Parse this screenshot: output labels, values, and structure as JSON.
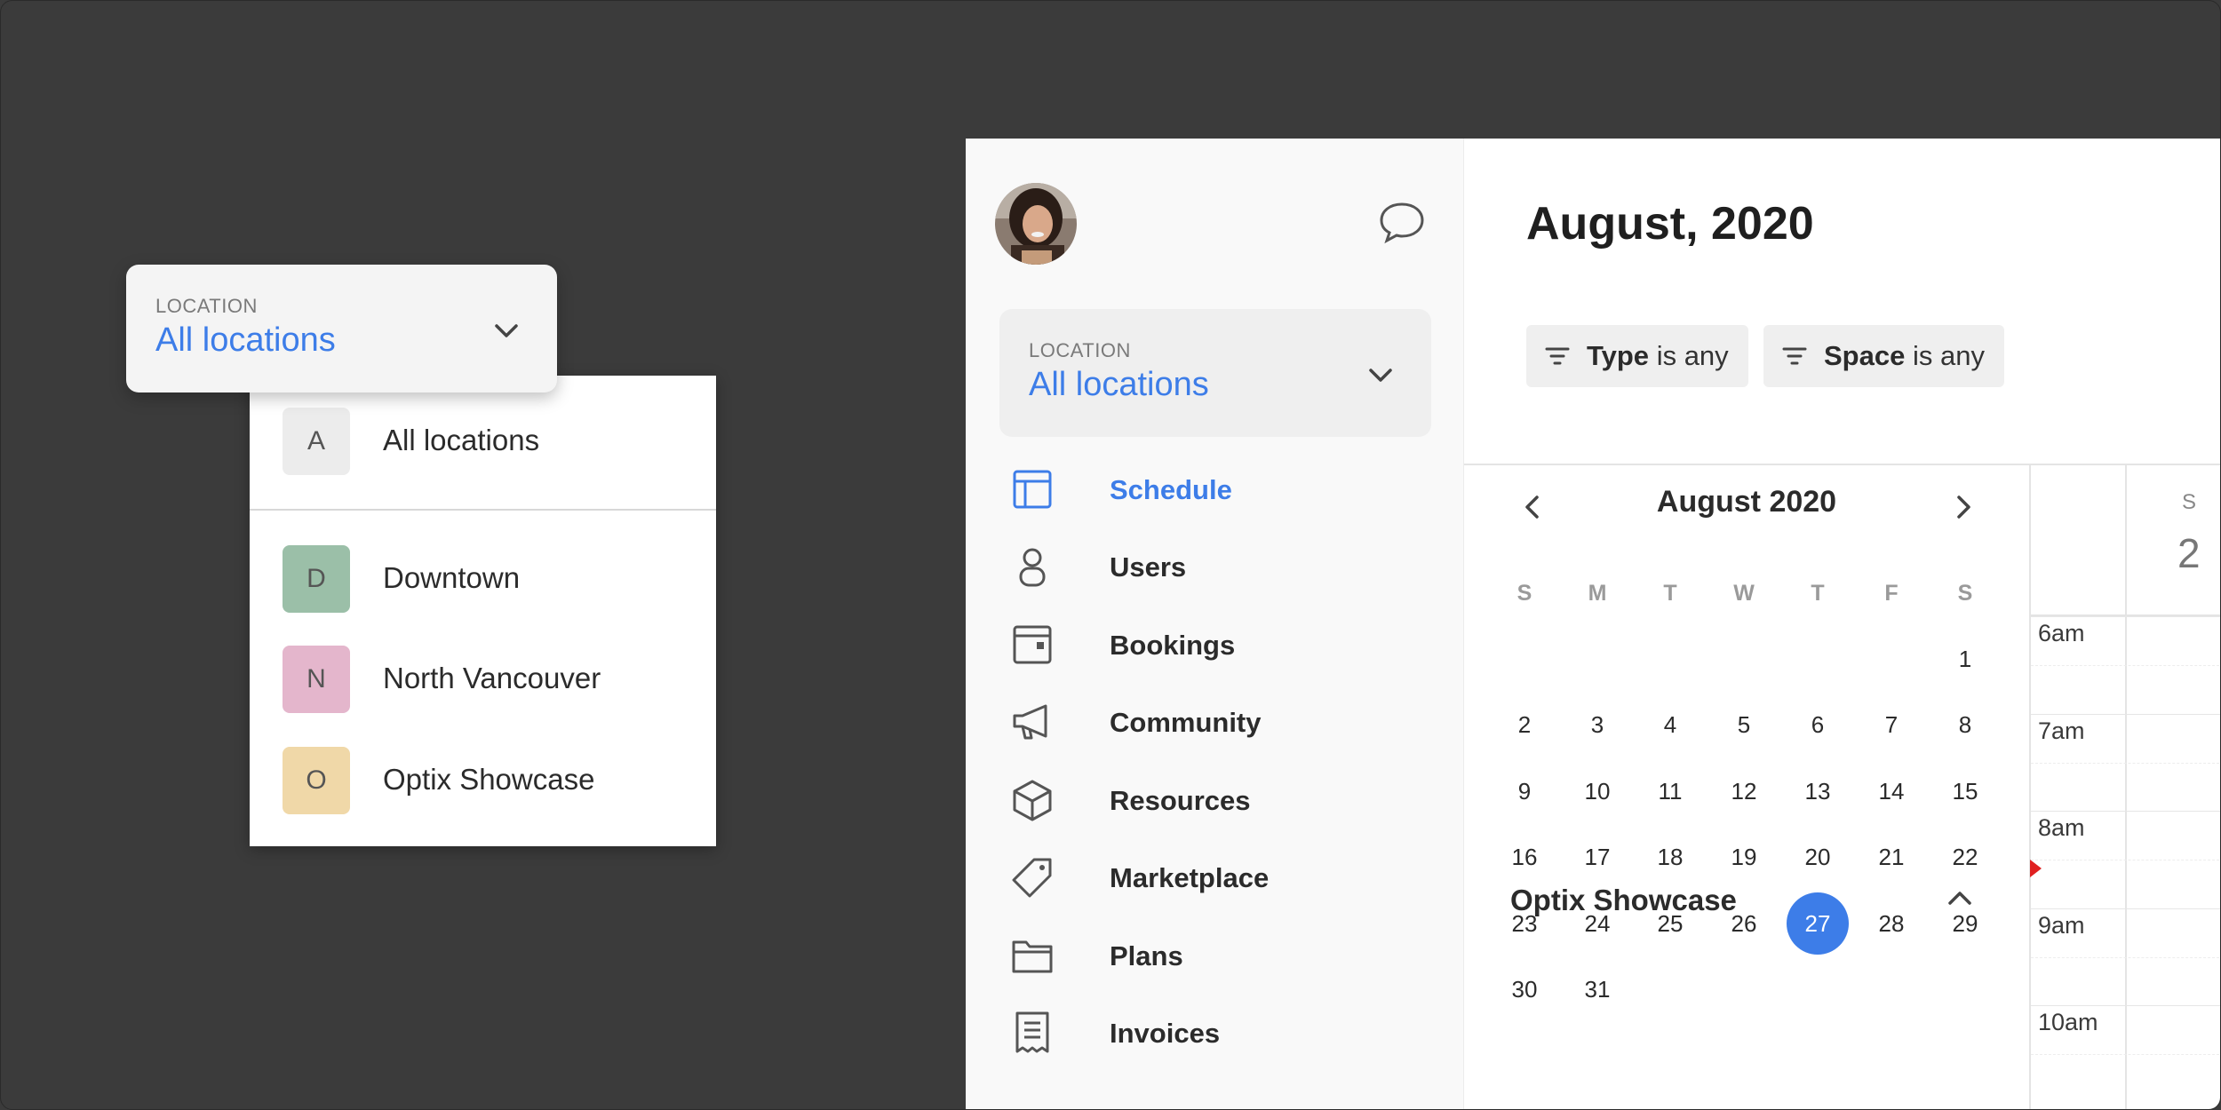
{
  "floating_location": {
    "label": "LOCATION",
    "value": "All locations"
  },
  "location_dropdown": {
    "items": [
      {
        "badge": "A",
        "label": "All locations",
        "color": "#ececec"
      },
      {
        "badge": "D",
        "label": "Downtown",
        "color": "#9bbfa8"
      },
      {
        "badge": "N",
        "label": "North Vancouver",
        "color": "#e4b6cc"
      },
      {
        "badge": "O",
        "label": "Optix Showcase",
        "color": "#f0d8a8"
      }
    ]
  },
  "sidebar": {
    "location": {
      "label": "LOCATION",
      "value": "All locations"
    },
    "nav": [
      {
        "label": "Schedule",
        "icon": "layout-icon",
        "active": true
      },
      {
        "label": "Users",
        "icon": "user-icon",
        "active": false
      },
      {
        "label": "Bookings",
        "icon": "calendar-box-icon",
        "active": false
      },
      {
        "label": "Community",
        "icon": "megaphone-icon",
        "active": false
      },
      {
        "label": "Resources",
        "icon": "cube-icon",
        "active": false
      },
      {
        "label": "Marketplace",
        "icon": "tag-icon",
        "active": false
      },
      {
        "label": "Plans",
        "icon": "folder-icon",
        "active": false
      },
      {
        "label": "Invoices",
        "icon": "receipt-icon",
        "active": false
      }
    ]
  },
  "header": {
    "title": "August, 2020"
  },
  "filters": {
    "type": {
      "key": "Type",
      "value": "is any"
    },
    "space": {
      "key": "Space",
      "value": "is any"
    }
  },
  "calendar": {
    "title": "August 2020",
    "weekdays": [
      "S",
      "M",
      "T",
      "W",
      "T",
      "F",
      "S"
    ],
    "first_weekday": 6,
    "days_in_month": 31,
    "selected_day": 27,
    "accent": "#3d7de8"
  },
  "showcase": {
    "label": "Optix Showcase"
  },
  "timeline": {
    "times": [
      "6am",
      "7am",
      "8am",
      "9am",
      "10am"
    ],
    "head_day": "S",
    "head_num": "2",
    "now_color": "#e02020"
  }
}
